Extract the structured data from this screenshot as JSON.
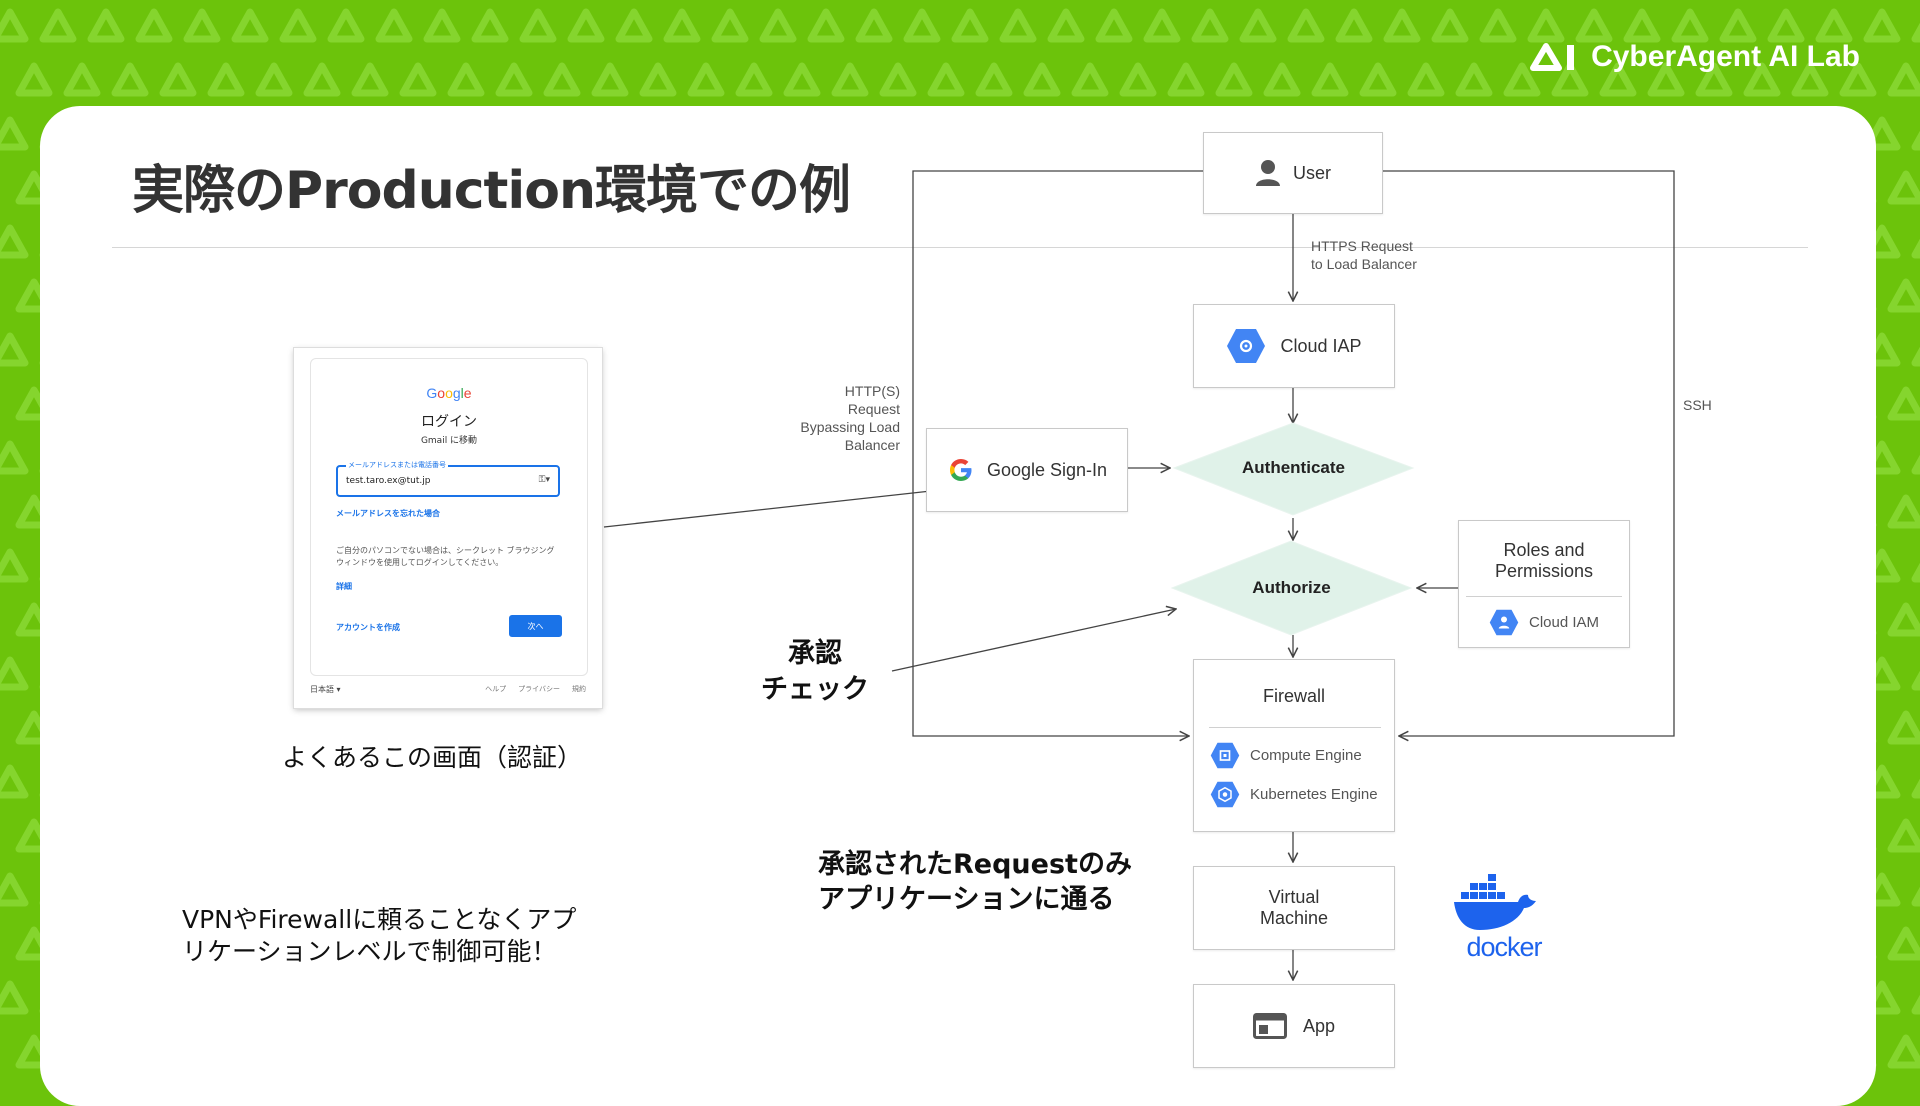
{
  "brand": {
    "logo_text": "CyberAgent AI Lab",
    "green": "#6cc30b"
  },
  "slide": {
    "title": "実際のProduction環境での例"
  },
  "login_mock": {
    "google": "Google",
    "heading": "ログイン",
    "subheading": "Gmail に移動",
    "field_label": "メールアドレスまたは電話番号",
    "field_value": "test.taro.ex@tut.jp",
    "field_icon": "key-icon",
    "forgot": "メールアドレスを忘れた場合",
    "notice": "ご自分のパソコンでない場合は、シークレット ブラウジング ウィンドウを使用してログインしてください。",
    "learn_more": "詳細",
    "create_account": "アカウントを作成",
    "next": "次へ",
    "language": "日本語 ▾",
    "footer": [
      "ヘルプ",
      "プライバシー",
      "規約"
    ]
  },
  "captions": {
    "login": "よくあるこの画面（認証）",
    "approval_check": [
      "承認",
      "チェック"
    ],
    "approved_requests": [
      "承認されたRequestのみ",
      "アプリケーションに通る"
    ],
    "vpn": [
      "VPNやFirewallに頼ることなくアプ",
      "リケーションレベルで制御可能！"
    ]
  },
  "diagram": {
    "user": "User",
    "https_request": [
      "HTTPS Request",
      "to Load Balancer"
    ],
    "cloud_iap": "Cloud IAP",
    "bypass": [
      "HTTP(S)",
      "Request",
      "Bypassing Load",
      "Balancer"
    ],
    "google_signin": "Google Sign-In",
    "authenticate": "Authenticate",
    "authorize": "Authorize",
    "roles": [
      "Roles and",
      "Permissions"
    ],
    "cloud_iam": "Cloud IAM",
    "ssh": "SSH",
    "firewall": "Firewall",
    "compute_engine": "Compute Engine",
    "kubernetes_engine": "Kubernetes Engine",
    "virtual_machine": [
      "Virtual",
      "Machine"
    ],
    "app": "App",
    "docker": "docker",
    "colors": {
      "gcp_blue": "#4285f4",
      "diamond_fill": "#e0f2e9",
      "line": "#444444"
    }
  }
}
